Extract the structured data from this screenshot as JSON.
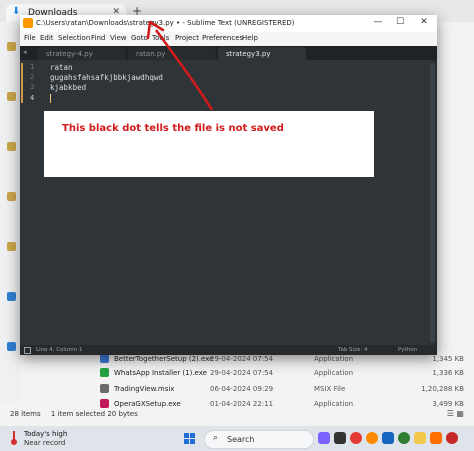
{
  "explorer": {
    "tab_label": "Downloads",
    "new_tab": "+",
    "files": [
      {
        "name": "BetterTogetherSetup (2).exe",
        "date": "29-04-2024 07:54",
        "type": "Application",
        "size": "1,345 KB",
        "color": "#3b7bd6"
      },
      {
        "name": "WhatsApp Installer (1).exe",
        "date": "29-04-2024 07:54",
        "type": "Application",
        "size": "1,336 KB",
        "color": "#25a244"
      },
      {
        "name": "TradingView.msix",
        "date": "06-04-2024 09:29",
        "type": "MSIX File",
        "size": "1,20,288 KB",
        "color": "#6b6b6b"
      },
      {
        "name": "OperaGXSetup.exe",
        "date": "01-04-2024 22:11",
        "type": "Application",
        "size": "3,499 KB",
        "color": "#c2185b"
      }
    ],
    "status": {
      "items": "28 items",
      "selected": "1 item selected 20 bytes"
    }
  },
  "sublime": {
    "title": "C:\\Users\\ratan\\Downloads\\strategy3.py • - Sublime Text (UNREGISTERED)",
    "window_buttons": {
      "minimize": "—",
      "maximize": "☐",
      "close": "✕"
    },
    "menu": [
      "File",
      "Edit",
      "Selection",
      "Find",
      "View",
      "Goto",
      "Tools",
      "Project",
      "Preferences",
      "Help"
    ],
    "tabs": [
      {
        "label": "strategy-4.py",
        "active": false
      },
      {
        "label": "ratan.py",
        "active": false
      },
      {
        "label": "strategy3.py",
        "active": true
      }
    ],
    "tab_nav_arrow": "◂",
    "line_numbers": [
      "1",
      "2",
      "3",
      "4"
    ],
    "code": [
      "ratan",
      "gugahsfahsafkjbbkjawdhqwd",
      "kjabkbed",
      ""
    ],
    "status_left": "Line 4, Column 1",
    "status_tab": "Tab Size: 4",
    "status_syntax": "Python"
  },
  "annotation": {
    "text": "This black dot tells the file is not saved",
    "color": "#d11a1a"
  },
  "taskbar": {
    "weather_line1": "Today's high",
    "weather_line2": "Near record",
    "search_label": "Search"
  }
}
